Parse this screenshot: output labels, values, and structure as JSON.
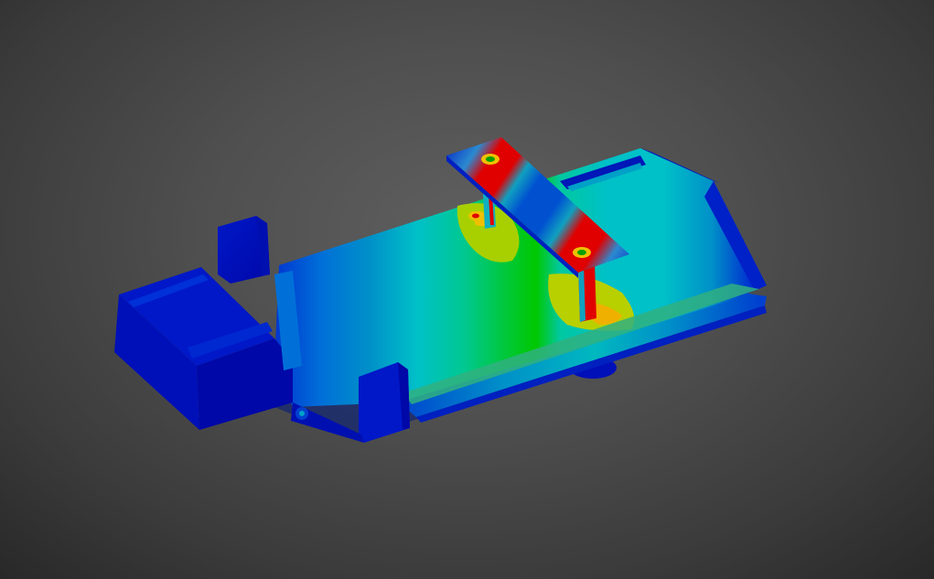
{
  "viewport": {
    "background": "dark-gray-gradient",
    "model": "fea-stress-contour-bracket-assembly",
    "contour_colors": [
      "#0000c8",
      "#0060d8",
      "#0090c8",
      "#00c0c8",
      "#00c840",
      "#a0d000",
      "#f0c000",
      "#f08000",
      "#e00000"
    ]
  }
}
